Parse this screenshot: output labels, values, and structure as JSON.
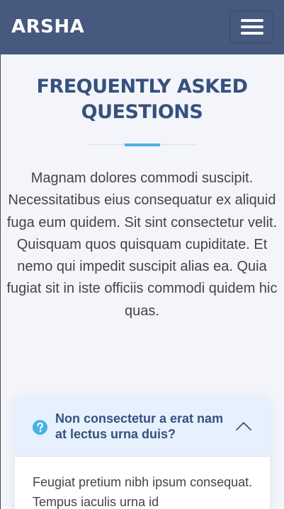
{
  "header": {
    "logo": "ARSHA",
    "menu_icon": "hamburger-menu-icon"
  },
  "section": {
    "title_line1": "FREQUENTLY ASKED",
    "title_line2": "QUESTIONS",
    "intro": "Magnam dolores commodi suscipit. Necessitatibus eius consequatur ex aliquid fuga eum quidem. Sit sint consectetur velit. Quisquam quos quisquam cupiditate. Et nemo qui impedit suscipit alias ea. Quia fugiat sit in iste officiis commodi quidem hic quas."
  },
  "faq": {
    "items": [
      {
        "icon": "question-circle-icon",
        "question": "Non consectetur a erat nam at lectus urna duis?",
        "answer": "Feugiat pretium nibh ipsum consequat. Tempus iaculis urna id",
        "toggle_icon": "chevron-up-icon",
        "expanded": true
      }
    ]
  },
  "colors": {
    "header_bg": "#47597e",
    "title": "#37517e",
    "accent": "#47b2e4",
    "page_bg": "#f3f5fa",
    "faq_head_bg": "#e7f1fd"
  }
}
